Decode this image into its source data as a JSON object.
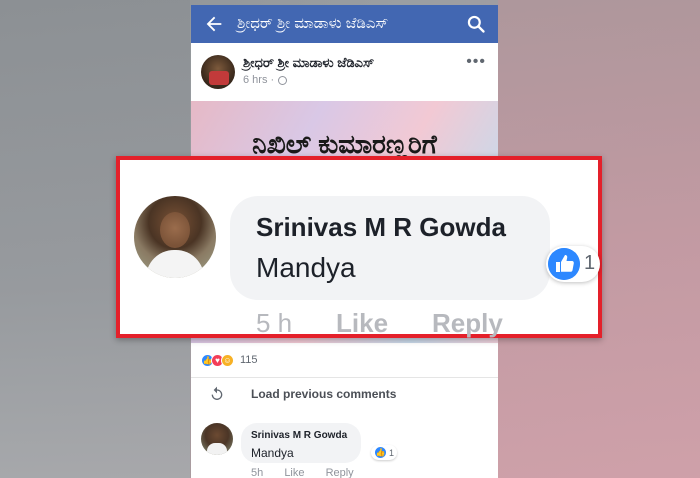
{
  "header": {
    "title": "ಶ್ರೀಧರ್ ಶ್ರೀ ಮಾಡಾಳು ಜೆಡಿಎಸ್",
    "back_icon": "arrow-left-icon",
    "search_icon": "search-icon",
    "bg_color": "#4267b2"
  },
  "post": {
    "author": "ಶ್ರೀಧರ್ ಶ್ರೀ ಮಾಡಾಳು ಜೆಡಿಎಸ್",
    "time": "6 hrs ·",
    "privacy_icon": "globe-icon",
    "more_icon": "ellipsis-icon",
    "image_text": "ನಿಖಿಲ್ ಕುಮಾರಣ್ಣರಿಗೆ",
    "reaction_count": "115",
    "reaction_types": [
      "like",
      "love",
      "haha"
    ]
  },
  "comments_section": {
    "load_previous_label": "Load previous comments",
    "refresh_icon": "refresh-icon"
  },
  "comment": {
    "author": "Srinivas M R Gowda",
    "text": "Mandya",
    "like_count": "1",
    "time": "5h",
    "like_label": "Like",
    "reply_label": "Reply"
  },
  "zoomed_comment": {
    "author": "Srinivas M R Gowda",
    "text": "Mandya",
    "like_count": "1",
    "time": "5 h",
    "like_label": "Like",
    "reply_label": "Reply",
    "border_color": "#e4202a"
  }
}
